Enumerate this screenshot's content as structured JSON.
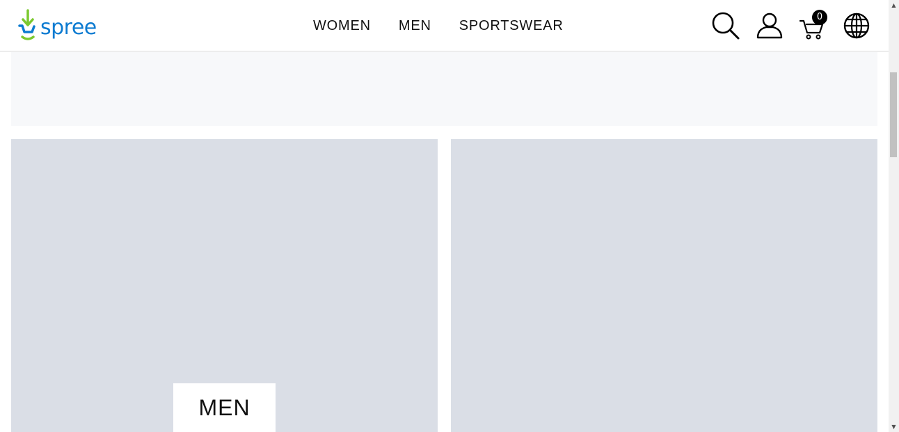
{
  "brand": {
    "logo_text": "spree",
    "colors": {
      "logo_text": "#0c7bd1",
      "logo_arrow": "#7bc92f",
      "logo_cart": "#0c7bd1"
    }
  },
  "nav": {
    "items": [
      {
        "label": "WOMEN"
      },
      {
        "label": "MEN"
      },
      {
        "label": "SPORTSWEAR"
      }
    ]
  },
  "header_icons": {
    "search": "search-icon",
    "account": "user-icon",
    "cart": "cart-icon",
    "cart_count": "0",
    "locale": "globe-icon"
  },
  "categories": {
    "men_label": "MEN"
  },
  "scrollbar": {
    "up_arrow": "▲",
    "down_arrow": "▼"
  }
}
